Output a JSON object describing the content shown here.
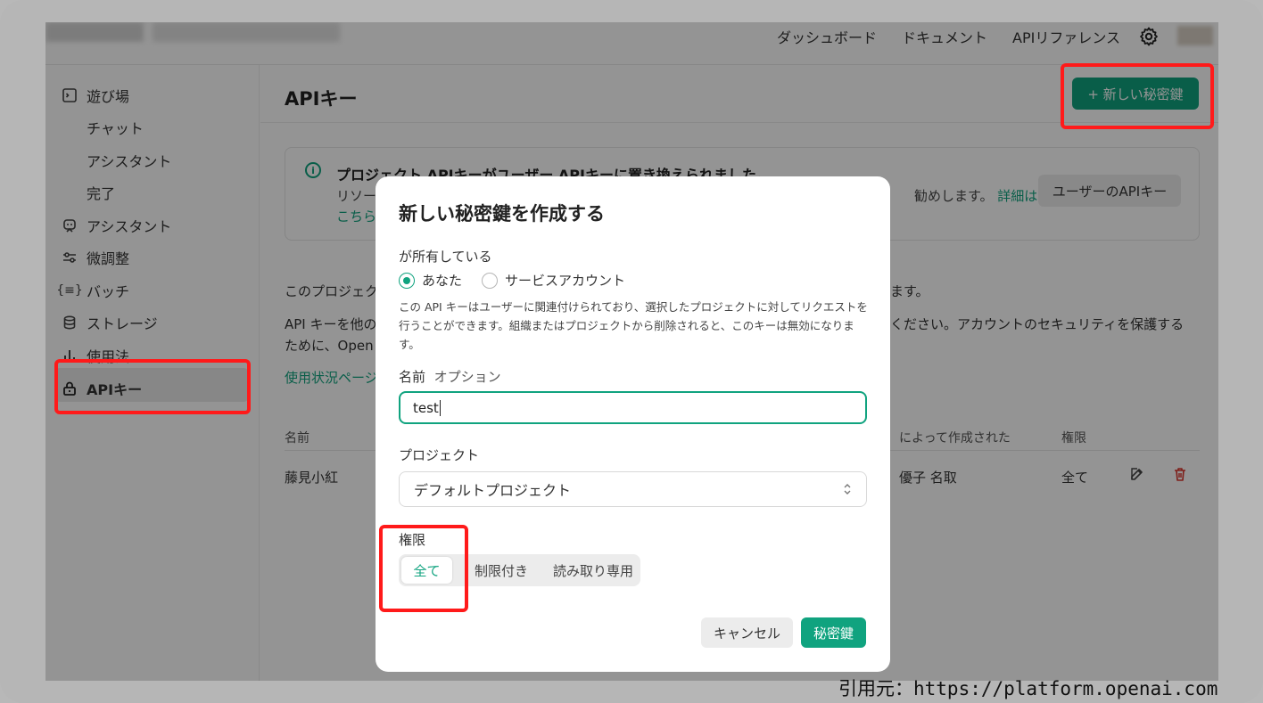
{
  "topbar": {
    "nav": [
      "ダッシュボード",
      "ドキュメント",
      "APIリファレンス"
    ],
    "settings_icon": "gear-icon"
  },
  "sidebar": {
    "items": [
      {
        "label": "遊び場",
        "icon": "terminal-icon"
      },
      {
        "label": "チャット"
      },
      {
        "label": "アシスタント"
      },
      {
        "label": "完了"
      },
      {
        "label": "アシスタント",
        "icon": "bot-icon"
      },
      {
        "label": "微調整",
        "icon": "sliders-icon"
      },
      {
        "label": "バッチ",
        "icon": "braces-icon"
      },
      {
        "label": "ストレージ",
        "icon": "database-icon"
      },
      {
        "label": "使用法",
        "icon": "bar-chart-icon"
      },
      {
        "label": "APIキー",
        "icon": "lock-icon"
      }
    ]
  },
  "main": {
    "title": "APIキー",
    "new_key_button": "+ 新しい秘密鍵",
    "notice": {
      "title": "プロジェクト APIキーがユーザー APIキーに置き換えられました。",
      "body_start": "リソー",
      "body_end": "勧めします。",
      "details_link": "詳細は",
      "link_line": "こちら",
      "user_keys_button": "ユーザーのAPIキー"
    },
    "para1_start": "このプロジェク",
    "para1_end": "ます。",
    "para2_start": "API キーを他の",
    "para2_end": "ください。アカウントのセキュリティを保護する",
    "para3": "ために、Open",
    "usage_link": "使用状況ページ",
    "table": {
      "headers": {
        "name": "名前",
        "created_by": "によって作成された",
        "permissions": "権限"
      },
      "row": {
        "name": "藤見小紅",
        "created_by": "優子 名取",
        "permissions": "全て"
      }
    }
  },
  "modal": {
    "title": "新しい秘密鍵を作成する",
    "owner_label": "が所有している",
    "owner_options": [
      "あなた",
      "サービスアカウント"
    ],
    "owner_selected": "あなた",
    "description": "この API キーはユーザーに関連付けられており、選択したプロジェクトに対してリクエストを行うことができます。組織またはプロジェクトから削除されると、このキーは無効になります。",
    "name_label": "名前",
    "name_optional": "オプション",
    "name_value": "test",
    "project_label": "プロジェクト",
    "project_value": "デフォルトプロジェクト",
    "permissions_label": "権限",
    "permission_options": [
      "全て",
      "制限付き",
      "読み取り専用"
    ],
    "permission_selected": "全て",
    "cancel_button": "キャンセル",
    "submit_button": "秘密鍵"
  },
  "credit": "引用元：https://platform.openai.com",
  "colors": {
    "accent": "#10a37f",
    "highlight": "#ff1a1a",
    "danger": "#d9342b"
  }
}
